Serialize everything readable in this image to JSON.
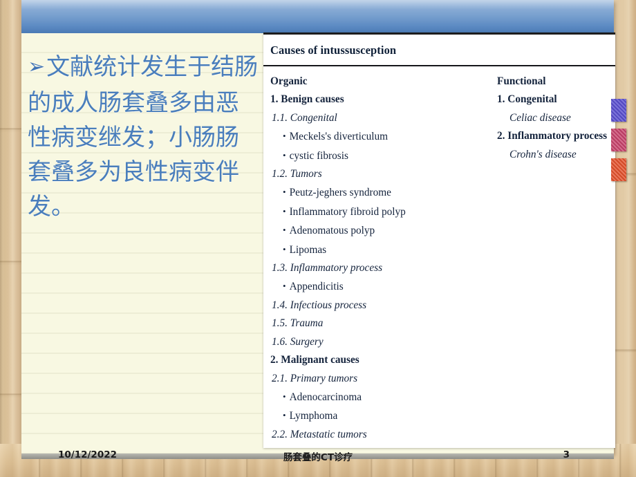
{
  "slide": {
    "body_text": "文献统计发生于结肠的成人肠套叠多由恶性病变继发；小肠肠套叠多为良性病变伴发。",
    "bullet_glyph": "➢",
    "accent_blue": "#4a7ebc",
    "paper_color": "#f8f8e2",
    "banner_color": "#5d8bc3"
  },
  "table": {
    "title": "Causes of intussusception",
    "left_column": {
      "heading": "Organic",
      "rows": [
        {
          "kind": "head",
          "text": "1. Benign causes"
        },
        {
          "kind": "sub",
          "text": "1.1. Congenital"
        },
        {
          "kind": "item",
          "text": "Meckels's diverticulum"
        },
        {
          "kind": "item",
          "text": "cystic fibrosis"
        },
        {
          "kind": "sub",
          "text": "1.2. Tumors"
        },
        {
          "kind": "item",
          "text": "Peutz-jeghers syndrome"
        },
        {
          "kind": "item",
          "text": "Inflammatory fibroid polyp"
        },
        {
          "kind": "item",
          "text": "Adenomatous polyp"
        },
        {
          "kind": "item",
          "text": "Lipomas"
        },
        {
          "kind": "sub",
          "text": "1.3. Inflammatory process"
        },
        {
          "kind": "item",
          "text": "Appendicitis"
        },
        {
          "kind": "sub",
          "text": "1.4. Infectious process"
        },
        {
          "kind": "sub",
          "text": "1.5. Trauma"
        },
        {
          "kind": "sub",
          "text": "1.6. Surgery"
        },
        {
          "kind": "head",
          "text": "2. Malignant causes"
        },
        {
          "kind": "sub",
          "text": "2.1. Primary tumors"
        },
        {
          "kind": "item",
          "text": "Adenocarcinoma"
        },
        {
          "kind": "item",
          "text": "Lymphoma"
        },
        {
          "kind": "sub",
          "text": "2.2. Metastatic tumors"
        }
      ]
    },
    "right_column": {
      "heading": "Functional",
      "rows": [
        {
          "kind": "head",
          "text": "1. Congenital"
        },
        {
          "kind": "italind",
          "text": "Celiac disease"
        },
        {
          "kind": "head",
          "text": "2. Inflammatory process"
        },
        {
          "kind": "italind",
          "text": "Crohn's disease"
        }
      ]
    },
    "bullet_dot": "•"
  },
  "chips": [
    {
      "name": "purple",
      "color": "#5a4fd0"
    },
    {
      "name": "pink",
      "color": "#c8426b"
    },
    {
      "name": "orange",
      "color": "#e4512b"
    }
  ],
  "footer": {
    "date": "10/12/2022",
    "center": "肠套叠的CT诊疗",
    "page_number": "3"
  }
}
